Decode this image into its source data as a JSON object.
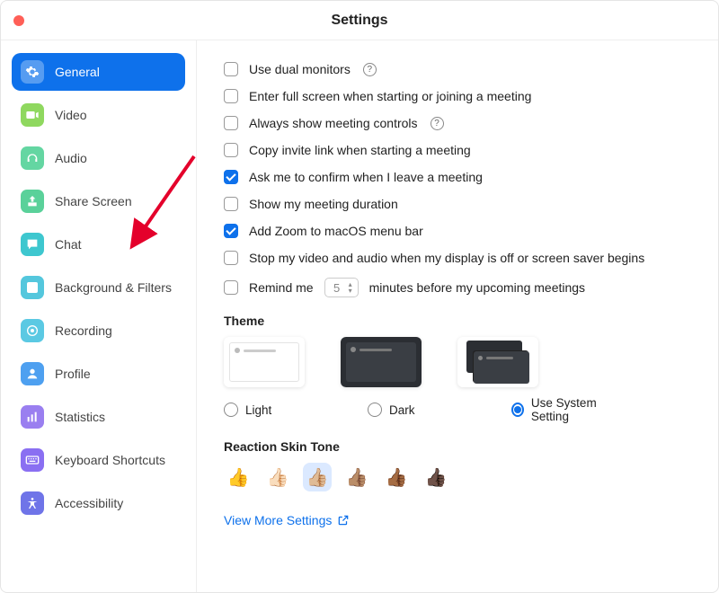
{
  "window": {
    "title": "Settings"
  },
  "sidebar": {
    "items": [
      {
        "label": "General",
        "icon": "gear",
        "color": "#ffffff40",
        "active": true
      },
      {
        "label": "Video",
        "icon": "video",
        "color": "#8fd85f"
      },
      {
        "label": "Audio",
        "icon": "headphones",
        "color": "#64d6a2"
      },
      {
        "label": "Share Screen",
        "icon": "share",
        "color": "#5ad19a"
      },
      {
        "label": "Chat",
        "icon": "chat",
        "color": "#3ec7cf"
      },
      {
        "label": "Background & Filters",
        "icon": "person-box",
        "color": "#54c7dd"
      },
      {
        "label": "Recording",
        "icon": "record",
        "color": "#5bc9e3"
      },
      {
        "label": "Profile",
        "icon": "profile",
        "color": "#4ea0f0"
      },
      {
        "label": "Statistics",
        "icon": "stats",
        "color": "#9a7ff0"
      },
      {
        "label": "Keyboard Shortcuts",
        "icon": "keyboard",
        "color": "#8a6ff2"
      },
      {
        "label": "Accessibility",
        "icon": "accessibility",
        "color": "#6f74e8"
      }
    ]
  },
  "options": [
    {
      "label": "Use dual monitors",
      "checked": false,
      "help": true
    },
    {
      "label": "Enter full screen when starting or joining a meeting",
      "checked": false
    },
    {
      "label": "Always show meeting controls",
      "checked": false,
      "help": true
    },
    {
      "label": "Copy invite link when starting a meeting",
      "checked": false
    },
    {
      "label": "Ask me to confirm when I leave a meeting",
      "checked": true
    },
    {
      "label": "Show my meeting duration",
      "checked": false
    },
    {
      "label": "Add Zoom to macOS menu bar",
      "checked": true
    },
    {
      "label": "Stop my video and audio when my display is off or screen saver begins",
      "checked": false
    }
  ],
  "remind": {
    "prefix": "Remind me",
    "value": "5",
    "suffix": "minutes before my upcoming meetings",
    "checked": false
  },
  "theme": {
    "title": "Theme",
    "options": [
      "Light",
      "Dark",
      "Use System Setting"
    ],
    "selected": 2
  },
  "skin": {
    "title": "Reaction Skin Tone",
    "tones": [
      "👍",
      "👍🏻",
      "👍🏼",
      "👍🏽",
      "👍🏾",
      "👍🏿"
    ],
    "selected": 2
  },
  "view_more": "View More Settings"
}
